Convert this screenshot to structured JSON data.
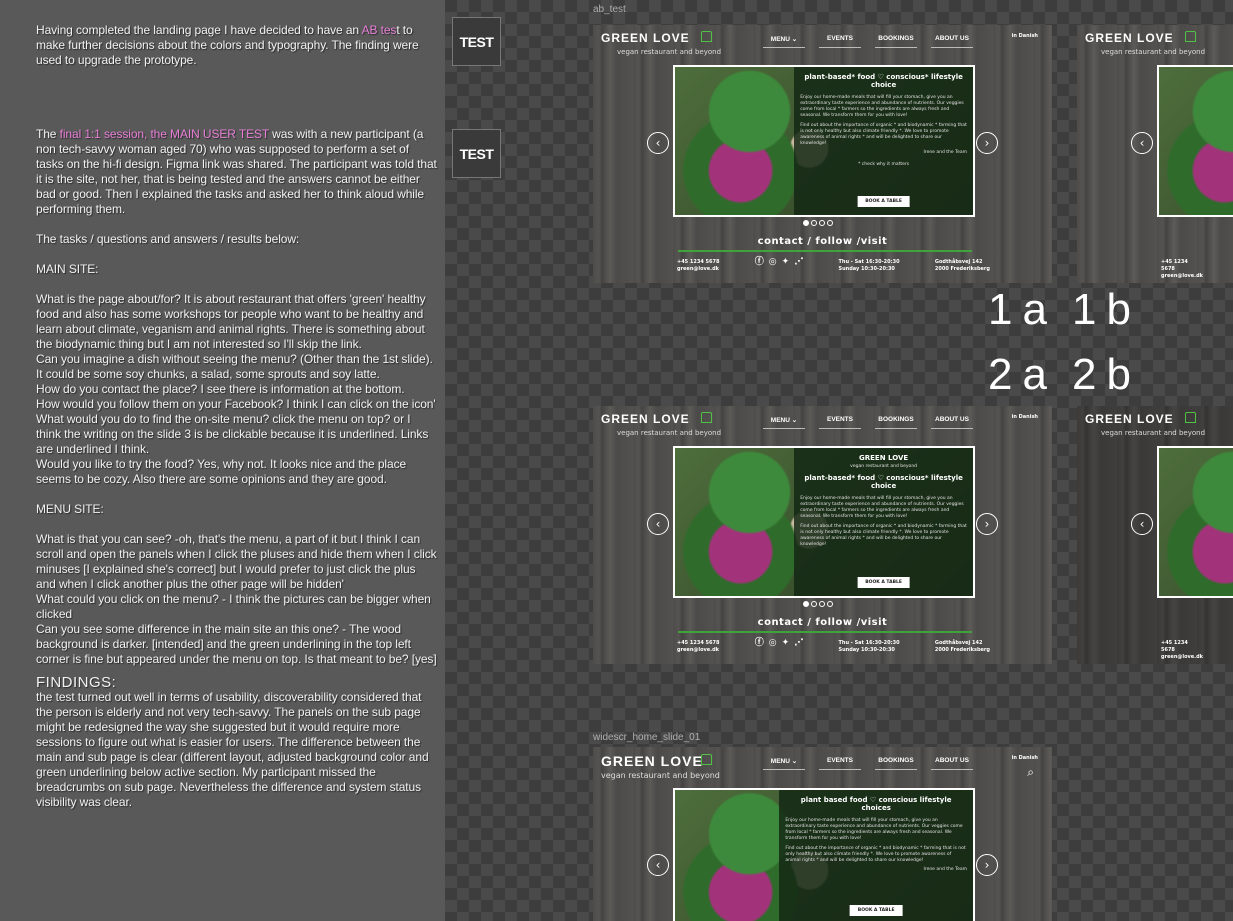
{
  "notes": {
    "p1_pre": "Having completed the landing page I have decided to have an ",
    "p1_link": "AB tes",
    "p1_post": "t to make further decisions about the colors and typography. The finding were used to upgrade the prototype.",
    "p2_pre": "The ",
    "p2_link": "final 1:1 session, the MAIN USER TEST",
    "p2_post": " was with a new participant (a non tech-savvy woman aged 70) who was supposed to perform a set of tasks on the hi-fi design. Figma link was shared. The participant was told that it is the site, not her, that is being tested and the answers cannot be either bad or good. Then I explained the tasks and asked her to think aloud while performing them.",
    "tasks_intro": "The tasks / questions and answers / results below:",
    "main_site_h": "MAIN SITE:",
    "main_site_text": "What is the page about/for?  It is about restaurant that offers 'green' healthy food and also has some workshops tor people who want to be healthy and learn about climate, veganism and animal rights. There is something about the biodynamic thing but I am not interested so I'll skip the link.\nCan you imagine a dish without seeing the menu? (Other than the 1st slide). It could be some soy chunks, a salad, some sprouts and soy latte.\nHow do you contact the place? I see there is information at the bottom.\nHow would you follow them on your Facebook? I think I can click on the icon'\nWhat would you do to find the on-site menu? click the menu on top? or I think the writing on the slide 3 is be clickable because it is underlined. Links are underlined I think.\nWould you like to try the food? Yes, why not. It looks nice and the place seems to be cozy. Also there are some opinions and they are good.",
    "menu_site_h": "MENU SITE:",
    "menu_site_text": "What is that you can see? -oh, that's the menu, a part of it but I think I can scroll and open the panels when I click the pluses and hide them when I click minuses [I explained she's correct] but I would prefer to just click the plus and when I click another plus the other page will be hidden'\nWhat could you click on the menu? - I think the pictures can be bigger when clicked\nCan you see some difference in the main site an this one? - The wood background is darker. [intended] and the green underlining in the top left corner is fine but appeared under the menu on top. Is that meant to be? [yes]",
    "findings_h": "FINDINGS:",
    "findings_text": "the test turned out well in terms of usability, discoverability considered that the person is elderly and not very tech-savvy. The panels on the sub page might be redesigned the way she suggested but it would require more sessions to figure out what is easier for users. The difference between the main and sub page is clear (different layout, adjusted background color and green underlining below active section. My participant missed the breadcrumbs on sub page. Nevertheless the difference and system status visibility was clear."
  },
  "test_buttons": [
    "TEST",
    "TEST"
  ],
  "frame_labels": [
    "ab_test",
    "widescr_home_slide_01"
  ],
  "variant_labels": [
    "1a",
    "1b",
    "2a",
    "2b"
  ],
  "site": {
    "brand": "GREEN LOVE",
    "tagline": "vegan restaurant and beyond",
    "nav": [
      "MENU ⌄",
      "EVENTS",
      "BOOKINGS",
      "ABOUT US"
    ],
    "lang": "in Danish",
    "hero_title": "plant-based* food  ♡ conscious* lifestyle choice",
    "hero_title_alt": "plant based food   ♡  conscious lifestyle choices",
    "hero_brand_title": "GREEN LOVE",
    "hero_body": "Enjoy our home-made meals that will fill your stomach, give you an extraordinary taste experience and abundance of nutrients. Our veggies come from local * farmers so the ingredients are always fresh and seasonal. We transform them for you with love!",
    "hero_small": "Find out about the importance of organic * and biodynamic * farming that is not only healthy but also climate friendly *. We love to promote awareness of animal rights * and will be delighted to share our knowledge!",
    "signature": "Irene and the Team",
    "check_why": "* check why it matters",
    "book_btn": "BOOK A TABLE",
    "contact_title": "contact / follow /visit",
    "phone": "+45 1234 5678",
    "email": "green@love.dk",
    "hours_days": "Thu - Sat   16:30-20:30",
    "hours_sun": "Sunday      10:30-20:30",
    "address1": "Godthåbsvej 142",
    "address2": "2000 Frederiksberg"
  },
  "colors": {
    "accent_pink": "#e87fd8",
    "brand_green": "#3fa33a"
  }
}
